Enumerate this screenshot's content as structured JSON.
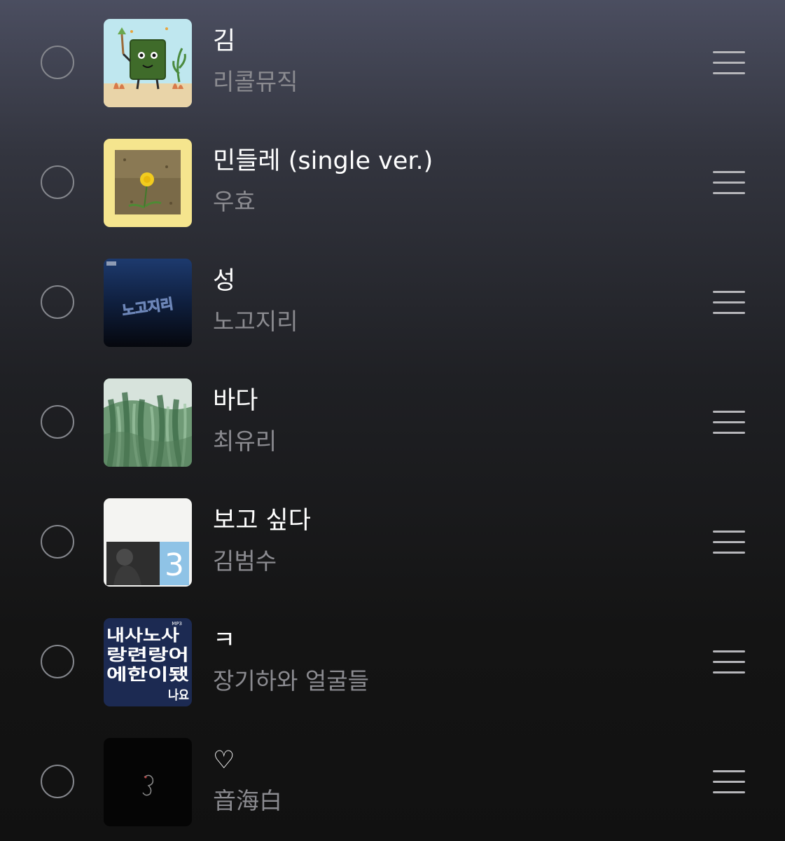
{
  "playlist": {
    "tracks": [
      {
        "title": "김",
        "artist": "리콜뮤직",
        "art": "seaweed-character-art"
      },
      {
        "title": "민들레 (single ver.)",
        "artist": "우효",
        "art": "dandelion-art"
      },
      {
        "title": "성",
        "artist": "노고지리",
        "art": "nogojiri-album-art",
        "art_text": "노고지리"
      },
      {
        "title": "바다",
        "artist": "최유리",
        "art": "green-painting-art"
      },
      {
        "title": "보고 싶다",
        "artist": "김범수",
        "art": "kim-bumsoo-3-art",
        "art_text": "3"
      },
      {
        "title": "ㅋ",
        "artist": "장기하와 얼굴들",
        "art": "jangkiha-album-art",
        "art_text": [
          "내사노사",
          "랑련랑어",
          "에한이됐",
          "나요"
        ],
        "art_badge": "MP3"
      },
      {
        "title": "♡",
        "artist": "音海白",
        "art": "black-minimal-art"
      }
    ]
  },
  "icons": {
    "select": "select-circle-icon",
    "reorder": "reorder-handle-icon"
  },
  "colors": {
    "title": "#ffffff",
    "artist": "#8b8b90",
    "handle": "#b6b6ba",
    "circle": "#85878d"
  }
}
